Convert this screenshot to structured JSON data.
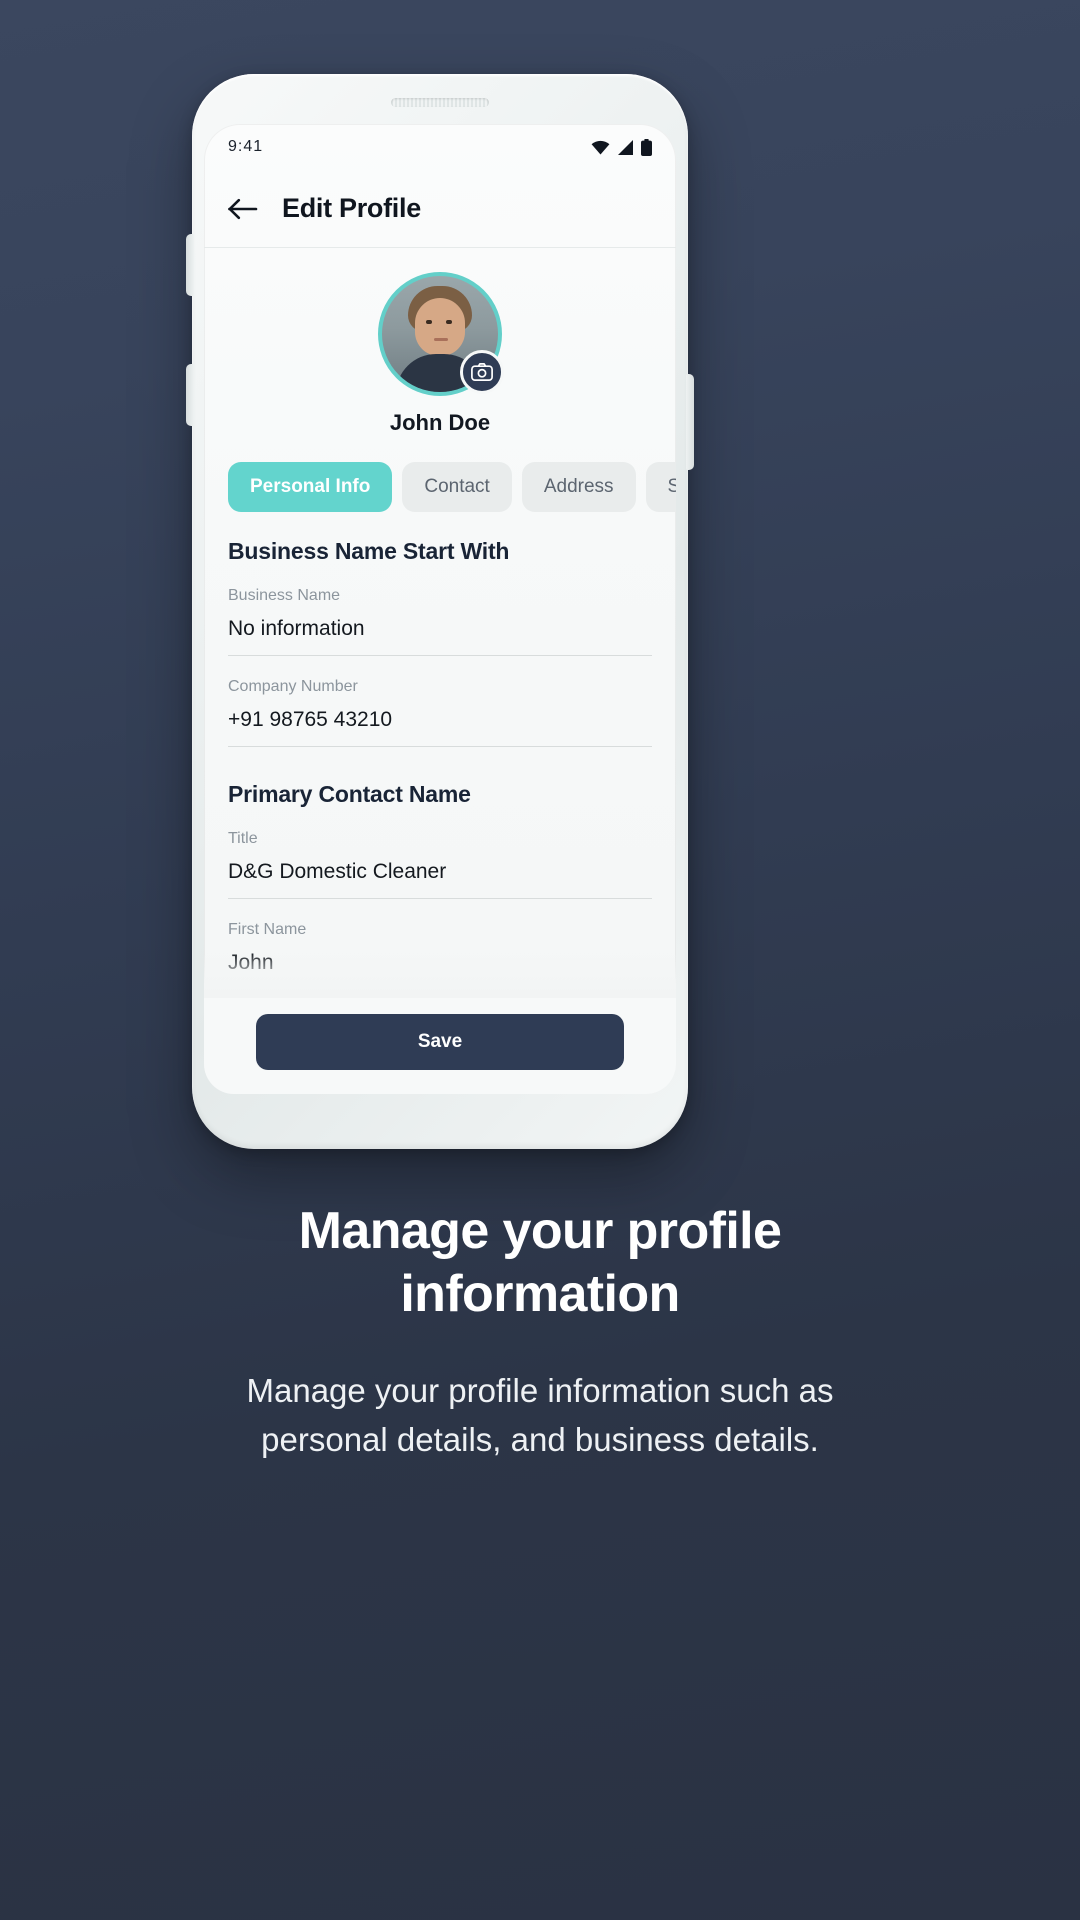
{
  "status_bar": {
    "time": "9:41",
    "icons": [
      "wifi-icon",
      "signal-icon",
      "battery-icon"
    ]
  },
  "app_bar": {
    "back_icon": "arrow-left-icon",
    "title": "Edit Profile"
  },
  "profile": {
    "name": "John Doe",
    "avatar_alt": "user-avatar",
    "camera_icon": "camera-icon",
    "ring_color": "#63cfc9"
  },
  "tabs": [
    {
      "label": "Personal Info",
      "active": true
    },
    {
      "label": "Contact",
      "active": false
    },
    {
      "label": "Address",
      "active": false
    },
    {
      "label": "S",
      "active": false
    }
  ],
  "form": {
    "sections": [
      {
        "title": "Business Name Start With",
        "fields": [
          {
            "label": "Business Name",
            "value": "No information"
          },
          {
            "label": "Company Number",
            "value": "+91 98765 43210"
          }
        ]
      },
      {
        "title": "Primary Contact Name",
        "fields": [
          {
            "label": "Title",
            "value": "D&G Domestic Cleaner"
          },
          {
            "label": "First Name",
            "value": "John"
          }
        ]
      }
    ]
  },
  "actions": {
    "save_label": "Save"
  },
  "caption": {
    "heading_line_1": "Manage your profile",
    "heading_line_2": "information",
    "subtitle_line_1": "Manage your profile information such as",
    "subtitle_line_2": "personal details, and business details."
  },
  "colors": {
    "background": "#2d3748",
    "accent_teal": "#63d4cd",
    "primary_navy": "#2f3c55",
    "text_dark": "#14191f",
    "text_muted": "#8c959d"
  }
}
